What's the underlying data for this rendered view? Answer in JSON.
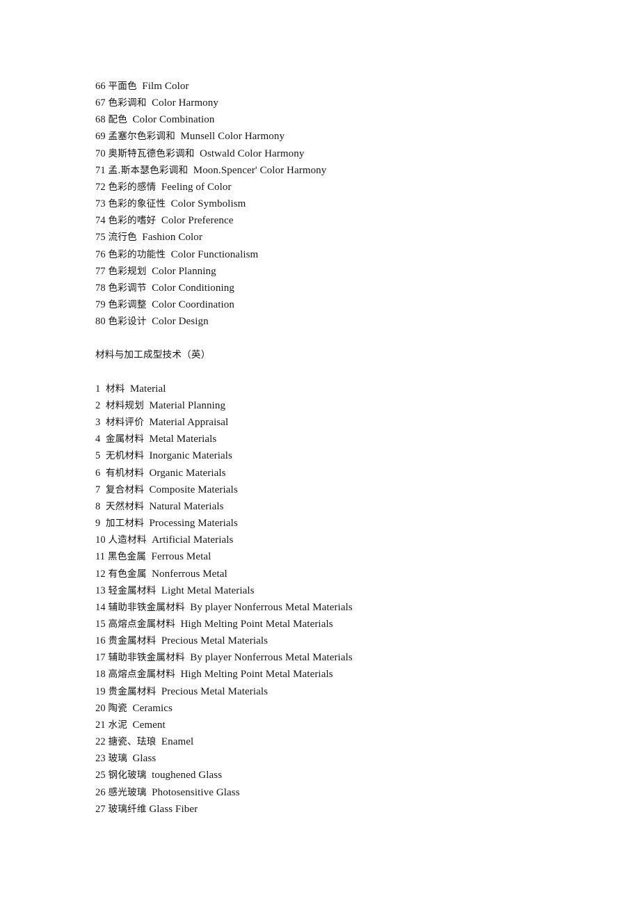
{
  "document": {
    "background_color": "#ffffff",
    "text_color": "#161616",
    "blocks": [
      {
        "type": "list",
        "name": "color-theory-term-list",
        "items": [
          {
            "number": "66",
            "cn": "平面色",
            "en": "Film Color"
          },
          {
            "number": "67",
            "cn": "色彩调和",
            "en": "Color Harmony"
          },
          {
            "number": "68",
            "cn": "配色",
            "en": "Color Combination"
          },
          {
            "number": "69",
            "cn": "孟塞尔色彩调和",
            "en": "Munsell Color Harmony"
          },
          {
            "number": "70",
            "cn": "奥斯特瓦德色彩调和",
            "en": "Ostwald Color Harmony"
          },
          {
            "number": "71",
            "cn": "孟.斯本瑟色彩调和",
            "en": "Moon.Spencer' Color Harmony"
          },
          {
            "number": "72",
            "cn": "色彩的感情",
            "en": "Feeling of Color"
          },
          {
            "number": "73",
            "cn": "色彩的象征性",
            "en": "Color Symbolism"
          },
          {
            "number": "74",
            "cn": "色彩的嗜好",
            "en": "Color Preference"
          },
          {
            "number": "75",
            "cn": "流行色",
            "en": "Fashion Color"
          },
          {
            "number": "76",
            "cn": "色彩的功能性",
            "en": "Color Functionalism"
          },
          {
            "number": "77",
            "cn": "色彩规划",
            "en": "Color Planning"
          },
          {
            "number": "78",
            "cn": "色彩调节",
            "en": "Color Conditioning"
          },
          {
            "number": "79",
            "cn": "色彩调整",
            "en": "Color Coordination"
          },
          {
            "number": "80",
            "cn": "色彩设计",
            "en": "Color Design"
          }
        ]
      },
      {
        "type": "heading",
        "name": "materials-section-heading",
        "text": "材料与加工成型技术（英）"
      },
      {
        "type": "list",
        "name": "materials-term-list",
        "items": [
          {
            "number": "1",
            "cn": "材料",
            "en": "Material"
          },
          {
            "number": "2",
            "cn": "材料规划",
            "en": "Material Planning"
          },
          {
            "number": "3",
            "cn": "材料评价",
            "en": "Material Appraisal"
          },
          {
            "number": "4",
            "cn": "金属材料",
            "en": "Metal Materials"
          },
          {
            "number": "5",
            "cn": "无机材料",
            "en": "Inorganic Materials"
          },
          {
            "number": "6",
            "cn": "有机材料",
            "en": "Organic Materials"
          },
          {
            "number": "7",
            "cn": "复合材料",
            "en": "Composite Materials"
          },
          {
            "number": "8",
            "cn": "天然材料",
            "en": "Natural Materials"
          },
          {
            "number": "9",
            "cn": "加工材料",
            "en": "Processing Materials"
          },
          {
            "number": "10",
            "cn": "人造材料",
            "en": "Artificial Materials"
          },
          {
            "number": "11",
            "cn": "黑色金属",
            "en": "Ferrous Metal"
          },
          {
            "number": "12",
            "cn": "有色金属",
            "en": "Nonferrous Metal"
          },
          {
            "number": "13",
            "cn": "轻金属材料",
            "en": "Light Metal Materials"
          },
          {
            "number": "14",
            "cn": "辅助非铁金属材料",
            "en": "By player Nonferrous Metal Materials"
          },
          {
            "number": "15",
            "cn": "高熔点金属材料",
            "en": "High Melting Point Metal Materials"
          },
          {
            "number": "16",
            "cn": "贵金属材料",
            "en": "Precious Metal Materials"
          },
          {
            "number": "17",
            "cn": "辅助非铁金属材料",
            "en": "By player Nonferrous Metal Materials"
          },
          {
            "number": "18",
            "cn": "高熔点金属材料",
            "en": "High Melting Point Metal Materials"
          },
          {
            "number": "19",
            "cn": "贵金属材料",
            "en": "Precious Metal Materials"
          },
          {
            "number": "20",
            "cn": "陶瓷",
            "en": "Ceramics"
          },
          {
            "number": "21",
            "cn": "水泥",
            "en": "Cement"
          },
          {
            "number": "22",
            "cn": "搪瓷、珐琅",
            "en": "Enamel"
          },
          {
            "number": "23",
            "cn": "玻璃",
            "en": "Glass"
          },
          {
            "number": "25",
            "cn": "钢化玻璃",
            "en": "toughened Glass"
          },
          {
            "number": "26",
            "cn": "感光玻璃",
            "en": "Photosensitive Glass"
          },
          {
            "number": "27",
            "cn": "玻璃纤维",
            "en": "Glass Fiber",
            "single_space": true
          }
        ]
      }
    ]
  }
}
